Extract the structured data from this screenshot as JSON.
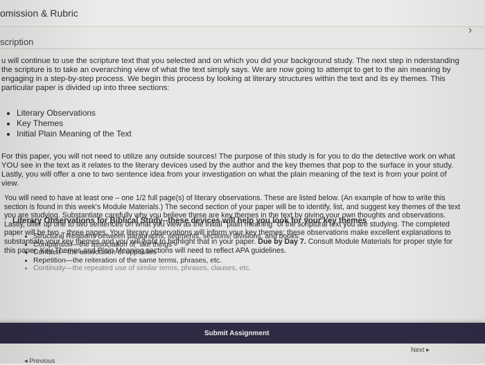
{
  "header": {
    "title": "omission & Rubric"
  },
  "section": {
    "label": "scription"
  },
  "icons": {
    "chevron": "›"
  },
  "paragraphs": {
    "p1": "u will continue to use the scripture text that you selected and on which you did your background study. The next step in nderstanding the scripture is to take an overarching view of what the text simply says. We are now going to attempt to get to the ain meaning by engaging in a step-by-step process. We begin this process by looking at literary structures within the text and its ey themes. This particular paper is divided up into three sections:",
    "p2": "For this paper, you will not need to utilize any outside sources! The purpose of this study is for you to do the detective work on what YOU see in the text as it relates to the literary devices used by the author and the key themes that pop to the surface in your study. Lastly, you will offer a one to two sentence idea from your investigation on what the plain meaning of the text is from your point of view.",
    "p3_part1": "You will need to have at least one – one 1/2 full page(s) of literary observations. These are listed below. (An example of how to write this section is found in this week's Module Materials.) The second section of your paper will be to identify, list, and suggest key themes of the text you are studying. Substantiate carefully why you believe these are key themes in the text by giving your own thoughts and observations. Lastly, offer up one to two sentences on what you view as the initial \"plain meaning\" of the scriptural text you are studying. The completed paper will be two – three pages. Your literary observations will inform your key themes; these observations make excellent explanations to substantiate your key themes and you will want to highlight that in your paper.",
    "p3_due": "Due by Day 7.",
    "p3_part2": "Consult Module Materials for proper style for this paper. Key Themes and Plain Meaning sections will need to reflect APA guidelines."
  },
  "sections_list": [
    "Literary Observations",
    "Key Themes",
    "Initial Plain Meaning of the Text"
  ],
  "literary": {
    "heading": "Literary Observations for Biblical Study--these devices will help you look for your key themes",
    "items": [
      "Structural Relations between paragraphs, segments, sections, divisions, and books.",
      "Comparison—the association of \"like things\"",
      "Contrast—the association of opposites",
      "Repetition—the reiteration of the same terms, phrases, etc.",
      "Continuity—the repeated use of similar terms, phrases, clauses, etc."
    ]
  },
  "actions": {
    "submit": "Submit Assignment",
    "next": "Next ▸",
    "previous": "◂ Previous"
  },
  "colors": {
    "bottom_bar": "#2f2b45",
    "background": "#e9e8e6"
  }
}
